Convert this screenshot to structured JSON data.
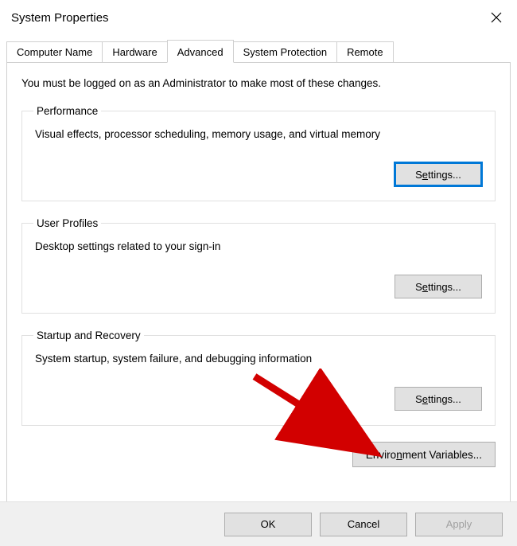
{
  "window": {
    "title": "System Properties"
  },
  "tabs": {
    "computer_name": "Computer Name",
    "hardware": "Hardware",
    "advanced": "Advanced",
    "system_protection": "System Protection",
    "remote": "Remote"
  },
  "advanced_panel": {
    "intro": "You must be logged on as an Administrator to make most of these changes.",
    "performance": {
      "legend": "Performance",
      "desc": "Visual effects, processor scheduling, memory usage, and virtual memory",
      "button_prefix": "S",
      "button_underline": "e",
      "button_suffix": "ttings..."
    },
    "user_profiles": {
      "legend": "User Profiles",
      "desc": "Desktop settings related to your sign-in",
      "button_prefix": "S",
      "button_underline": "e",
      "button_suffix": "ttings..."
    },
    "startup_recovery": {
      "legend": "Startup and Recovery",
      "desc": "System startup, system failure, and debugging information",
      "button_prefix": "S",
      "button_underline": "e",
      "button_suffix": "ttings..."
    },
    "env_vars": {
      "prefix": "Enviro",
      "underline": "n",
      "suffix": "ment Variables..."
    }
  },
  "buttons": {
    "ok": "OK",
    "cancel": "Cancel",
    "apply": "Apply"
  }
}
